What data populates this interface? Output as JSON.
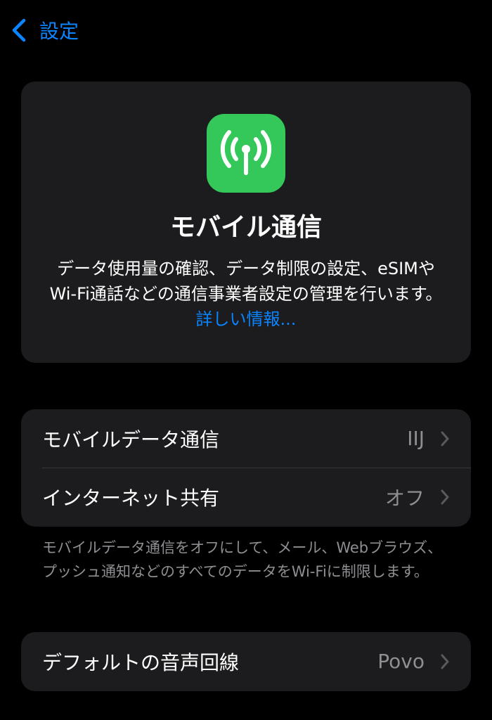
{
  "nav": {
    "back_label": "設定"
  },
  "hero": {
    "icon": "antenna-radiowaves-icon",
    "title": "モバイル通信",
    "description": "データ使用量の確認、データ制限の設定、eSIMやWi‑Fi通話などの通信事業者設定の管理を行います。",
    "link_label": "詳しい情報..."
  },
  "cellular_group": {
    "rows": [
      {
        "label": "モバイルデータ通信",
        "value": "IIJ"
      },
      {
        "label": "インターネット共有",
        "value": "オフ"
      }
    ],
    "footnote": "モバイルデータ通信をオフにして、メール、Webブラウズ、プッシュ通知などのすべてのデータをWi‑Fiに制限します。"
  },
  "voice_group": {
    "rows": [
      {
        "label": "デフォルトの音声回線",
        "value": "Povo"
      }
    ]
  },
  "colors": {
    "accent": "#0a84ff",
    "icon_background": "#34c759",
    "cell_background": "#1c1c1e",
    "secondary_text": "#8e8e93"
  }
}
